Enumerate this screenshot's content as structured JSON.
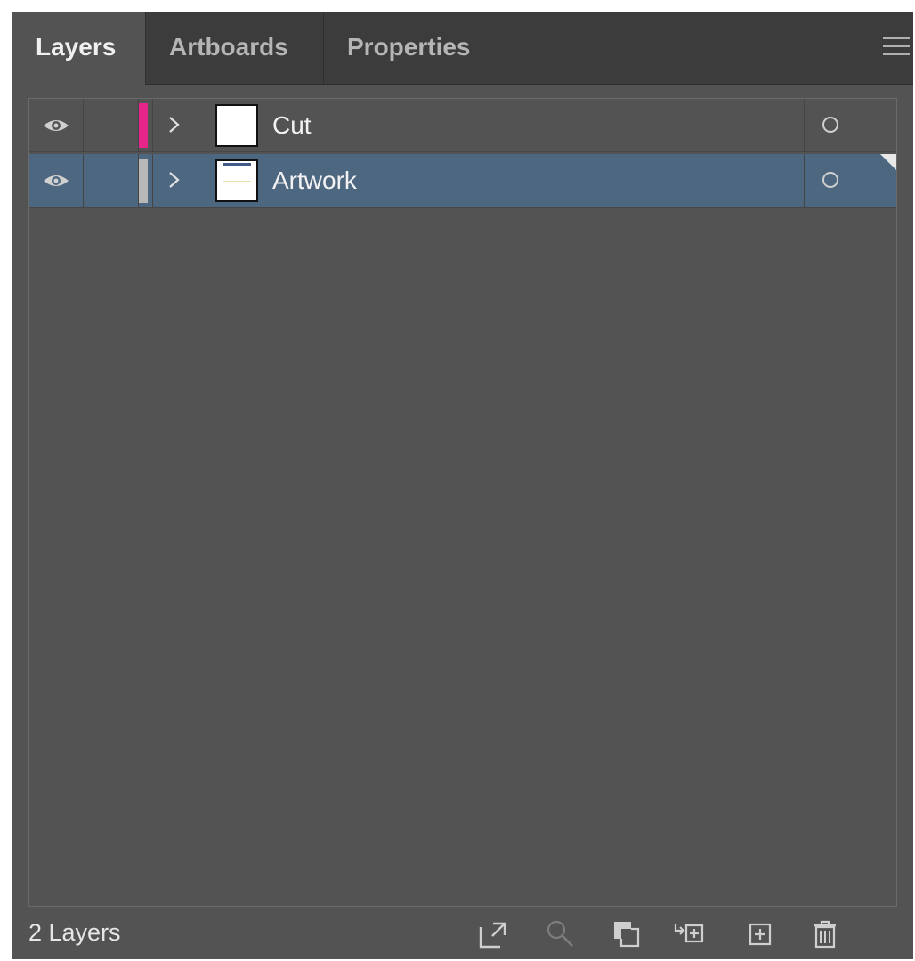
{
  "tabs": [
    {
      "label": "Layers",
      "active": true
    },
    {
      "label": "Artboards",
      "active": false
    },
    {
      "label": "Properties",
      "active": false
    }
  ],
  "panel_menu_icon": "hamburger-menu-icon",
  "layers": [
    {
      "name": "Cut",
      "color": "#e6258a",
      "visible": true,
      "selected": false,
      "thumbnail": "blank"
    },
    {
      "name": "Artwork",
      "color": "#b8b8b8",
      "visible": true,
      "selected": true,
      "thumbnail": "artwork"
    }
  ],
  "footer": {
    "count_label": "2 Layers",
    "tools": [
      {
        "icon": "export-icon",
        "enabled": true
      },
      {
        "icon": "search-icon",
        "enabled": false
      },
      {
        "icon": "clipping-mask-icon",
        "enabled": true
      },
      {
        "icon": "new-sublayer-icon",
        "enabled": true
      },
      {
        "icon": "new-layer-icon",
        "enabled": true
      },
      {
        "icon": "trash-icon",
        "enabled": true
      }
    ]
  },
  "colors": {
    "panel_bg": "#535353",
    "tabbar_bg": "#3c3c3c",
    "selection": "#4e6780"
  }
}
